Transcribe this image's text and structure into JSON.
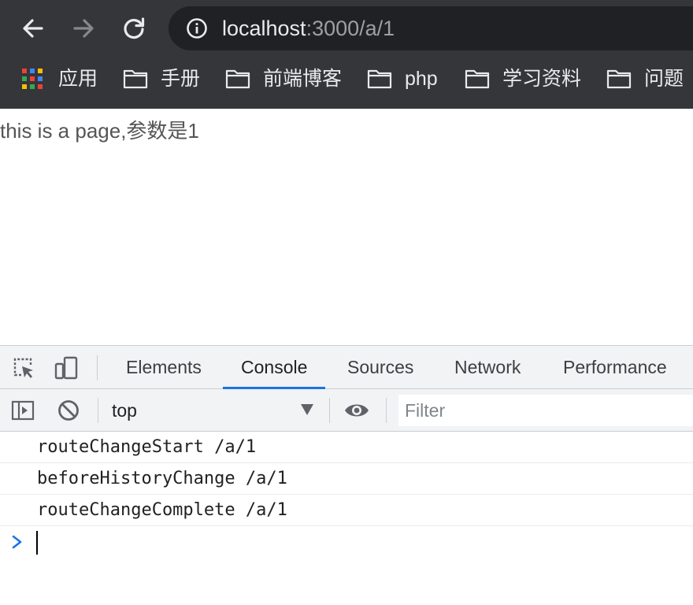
{
  "browser": {
    "url_host": "localhost",
    "url_path": ":3000/a/1",
    "bookmarks": [
      {
        "label": "应用",
        "icon": "apps-grid-icon"
      },
      {
        "label": "手册",
        "icon": "folder-icon"
      },
      {
        "label": "前端博客",
        "icon": "folder-icon"
      },
      {
        "label": "php",
        "icon": "folder-icon"
      },
      {
        "label": "学习资料",
        "icon": "folder-icon"
      },
      {
        "label": "问题",
        "icon": "folder-icon"
      }
    ]
  },
  "page": {
    "text": "this is a page,参数是1"
  },
  "devtools": {
    "tabs": [
      {
        "label": "Elements",
        "active": false
      },
      {
        "label": "Console",
        "active": true
      },
      {
        "label": "Sources",
        "active": false
      },
      {
        "label": "Network",
        "active": false
      },
      {
        "label": "Performance",
        "active": false
      }
    ],
    "toolbar": {
      "context": "top",
      "filter_placeholder": "Filter"
    },
    "console_lines": [
      "routeChangeStart /a/1",
      "beforeHistoryChange /a/1",
      "routeChangeComplete /a/1"
    ]
  },
  "colors": {
    "chrome_bg": "#35363a",
    "omnibox_bg": "#202124",
    "accent": "#1a73e8"
  }
}
